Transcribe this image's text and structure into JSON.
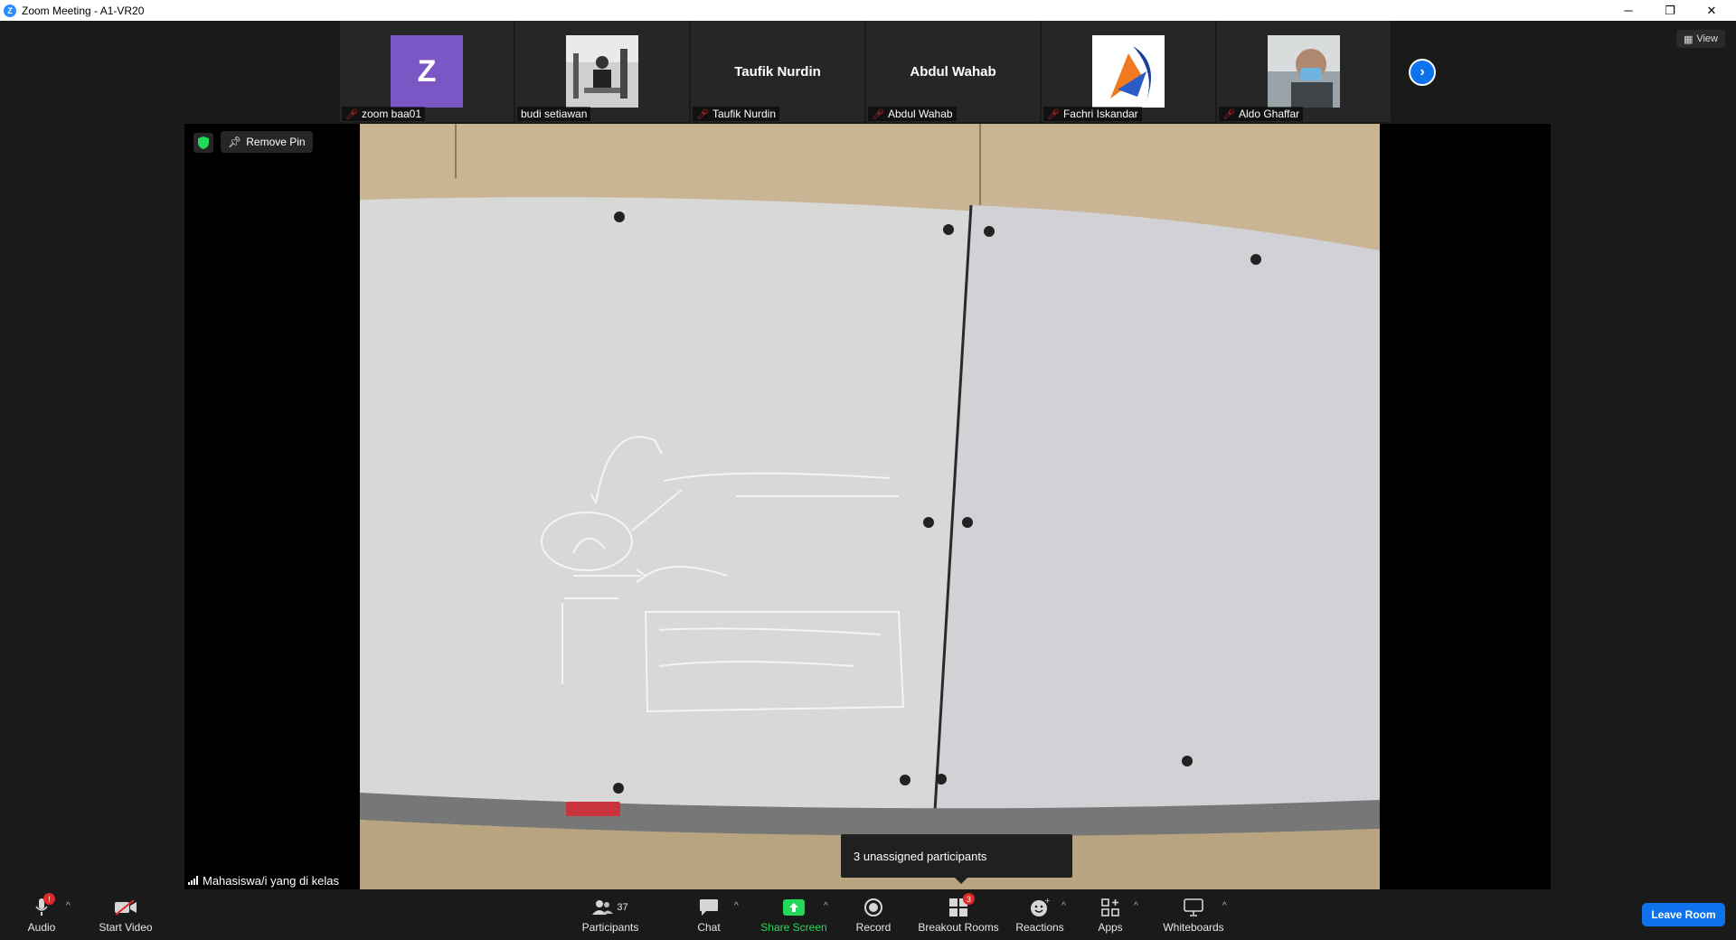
{
  "window": {
    "title": "Zoom Meeting - A1-VR20",
    "minimize": "─",
    "restore": "❐",
    "close": "✕"
  },
  "view_button": {
    "label": "View"
  },
  "thumbnails": [
    {
      "name": "zoom baa01",
      "kind": "avatar",
      "avatar_letter": "Z",
      "avatar_color": "#7b57c6",
      "muted": true
    },
    {
      "name": "budi setiawan",
      "kind": "photo",
      "muted": false
    },
    {
      "name": "Taufik Nurdin",
      "kind": "text",
      "tile_text": "Taufik Nurdin",
      "muted": true
    },
    {
      "name": "Abdul Wahab",
      "kind": "text",
      "tile_text": "Abdul Wahab",
      "muted": true
    },
    {
      "name": "Fachri Iskandar",
      "kind": "logo",
      "muted": true
    },
    {
      "name": "Aldo Ghaffar",
      "kind": "photo",
      "muted": true
    }
  ],
  "main_video": {
    "remove_pin_label": "Remove Pin",
    "speaker_name": "Mahasiswa/i yang di kelas"
  },
  "tooltip": {
    "text": "3 unassigned participants"
  },
  "toolbar": {
    "audio": "Audio",
    "start_video": "Start Video",
    "participants": "Participants",
    "participants_count": "37",
    "chat": "Chat",
    "share_screen": "Share Screen",
    "record": "Record",
    "breakout_rooms": "Breakout Rooms",
    "breakout_badge": "3",
    "reactions": "Reactions",
    "apps": "Apps",
    "whiteboards": "Whiteboards",
    "leave": "Leave Room",
    "audio_badge": "!"
  },
  "colors": {
    "accent": "#0e72ed",
    "share_green": "#23d959",
    "muted_red": "#e02828"
  }
}
